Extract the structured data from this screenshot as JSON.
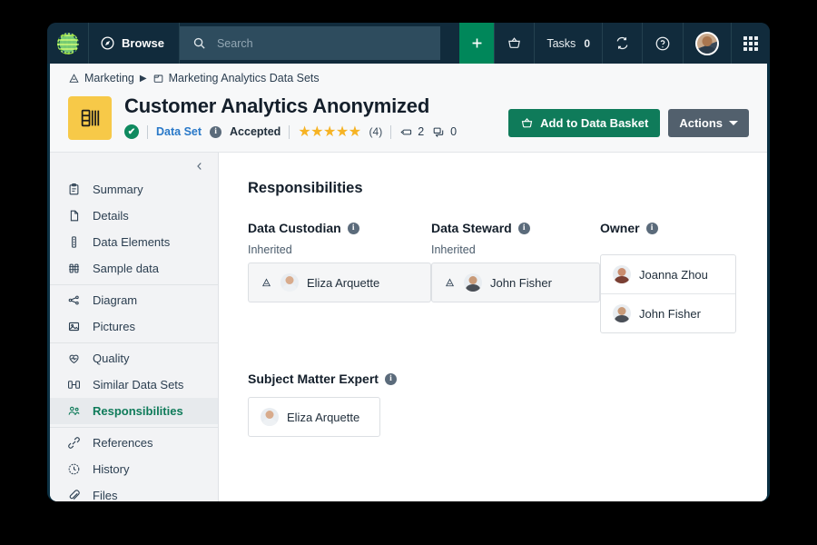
{
  "topnav": {
    "logo_icon": "app-logo-icon",
    "browse_label": "Browse",
    "browse_icon": "compass-icon",
    "search_icon": "search-icon",
    "search_placeholder": "Search",
    "search_value": "",
    "plus_label": "+",
    "basket_icon": "basket-icon",
    "tasks_label": "Tasks",
    "tasks_count": "0",
    "sync_icon": "sync-icon",
    "help_icon": "help-circle-icon",
    "avatar_icon": "user-avatar",
    "apps_icon": "app-grid-icon"
  },
  "breadcrumb": {
    "items": [
      {
        "label": "Marketing",
        "icon": "domain-icon"
      },
      {
        "label": "Marketing Analytics Data Sets",
        "icon": "folder-icon"
      }
    ],
    "separator": "▶"
  },
  "header": {
    "asset_icon": "data-set-icon",
    "title": "Customer Analytics Anonymized",
    "verified_mark": "✔",
    "type_label": "Data Set",
    "status_label": "Accepted",
    "stars": "★★★★★",
    "rating_count": "(4)",
    "tag_count": "2",
    "comment_count": "0",
    "tag_icon": "tag-icon",
    "comment_icon": "comment-icon",
    "info_icon": "info-icon",
    "primary_button": "Add to Data Basket",
    "primary_button_icon": "basket-icon",
    "secondary_button": "Actions",
    "accent_green": "#0f7b5a",
    "accent_amber": "#f7c948",
    "link_blue": "#2878c8"
  },
  "sidebar": {
    "collapse_icon": "chevron-left-icon",
    "groups": [
      {
        "items": [
          {
            "label": "Summary",
            "icon": "clipboard-icon",
            "active": false
          },
          {
            "label": "Details",
            "icon": "document-icon",
            "active": false
          },
          {
            "label": "Data Elements",
            "icon": "data-elements-icon",
            "active": false
          },
          {
            "label": "Sample data",
            "icon": "sample-data-icon",
            "active": false
          }
        ]
      },
      {
        "items": [
          {
            "label": "Diagram",
            "icon": "diagram-icon",
            "active": false
          },
          {
            "label": "Pictures",
            "icon": "pictures-icon",
            "active": false
          }
        ]
      },
      {
        "items": [
          {
            "label": "Quality",
            "icon": "quality-heart-icon",
            "active": false
          },
          {
            "label": "Similar Data Sets",
            "icon": "similar-data-sets-icon",
            "active": false
          },
          {
            "label": "Responsibilities",
            "icon": "people-icon",
            "active": true
          }
        ]
      },
      {
        "items": [
          {
            "label": "References",
            "icon": "references-link-icon",
            "active": false
          },
          {
            "label": "History",
            "icon": "history-clock-icon",
            "active": false
          },
          {
            "label": "Files",
            "icon": "paperclip-icon",
            "active": false
          }
        ]
      }
    ]
  },
  "main": {
    "section_title": "Responsibilities",
    "inherited_label": "Inherited",
    "inherit_icon": "inherited-icon",
    "info_icon": "info-icon",
    "roles": [
      {
        "label": "Data Custodian",
        "inherited": true,
        "people": [
          {
            "name": "Eliza Arquette",
            "avatar": "avatar-eliza"
          }
        ]
      },
      {
        "label": "Data Steward",
        "inherited": true,
        "people": [
          {
            "name": "John Fisher",
            "avatar": "avatar-john"
          }
        ]
      },
      {
        "label": "Owner",
        "inherited": false,
        "people": [
          {
            "name": "Joanna Zhou",
            "avatar": "avatar-joanna"
          },
          {
            "name": "John Fisher",
            "avatar": "avatar-john"
          }
        ]
      }
    ],
    "sme": {
      "label": "Subject Matter Expert",
      "inherited": false,
      "people": [
        {
          "name": "Eliza Arquette",
          "avatar": "avatar-eliza"
        }
      ]
    }
  }
}
